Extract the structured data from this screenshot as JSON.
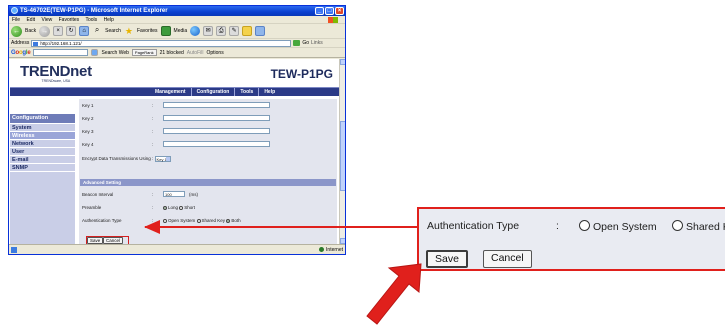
{
  "browser": {
    "title": "TS-46702E(TEW-P1PG) - Microsoft Internet Explorer",
    "menu": [
      "File",
      "Edit",
      "View",
      "Favorites",
      "Tools",
      "Help"
    ],
    "toolbar": {
      "back": "Back",
      "search": "Search",
      "favorites": "Favorites",
      "media": "Media"
    },
    "address_label": "Address",
    "address": "http://192.168.1.121/",
    "go": "Go",
    "links": "Links",
    "google": {
      "search_web": "Search Web",
      "pagerank": "PageRank",
      "blocked": "21 blocked",
      "autofill": "AutoFill",
      "options": "Options"
    },
    "status_zone": "Internet"
  },
  "page": {
    "logo": "TRENDnet",
    "logo_tagline": "TRENDware, USA",
    "model": "TEW-P1PG",
    "tabs": [
      "Management",
      "Configuration",
      "Tools",
      "Help"
    ],
    "sidebar": {
      "header": "Configuration",
      "items": [
        "System",
        "Wireless",
        "Network",
        "User",
        "E-mail",
        "SNMP"
      ],
      "active_index": 1
    },
    "form": {
      "keys": [
        "Key 1",
        "Key 2",
        "Key 3",
        "Key 4"
      ],
      "encrypt_label": "Encrypt Data Transmissions Using",
      "encrypt_value": "Key 1",
      "advanced_header": "Advanced Setting",
      "beacon_label": "Beacon Interval",
      "beacon_value": "100",
      "beacon_unit": "(ms)",
      "preamble_label": "Preamble",
      "preamble_options": [
        "Long",
        "Short"
      ],
      "auth_label": "Authentication Type",
      "auth_options": [
        "Open System",
        "Shared Key",
        "Both"
      ],
      "save": "Save",
      "cancel": "Cancel"
    }
  },
  "callout": {
    "auth_label": "Authentication Type",
    "colon": ":",
    "opt1": "Open System",
    "opt2": "Shared K",
    "save": "Save",
    "cancel": "Cancel"
  },
  "colors": {
    "accent_red": "#e0201c",
    "nav_blue": "#2b3a87"
  }
}
